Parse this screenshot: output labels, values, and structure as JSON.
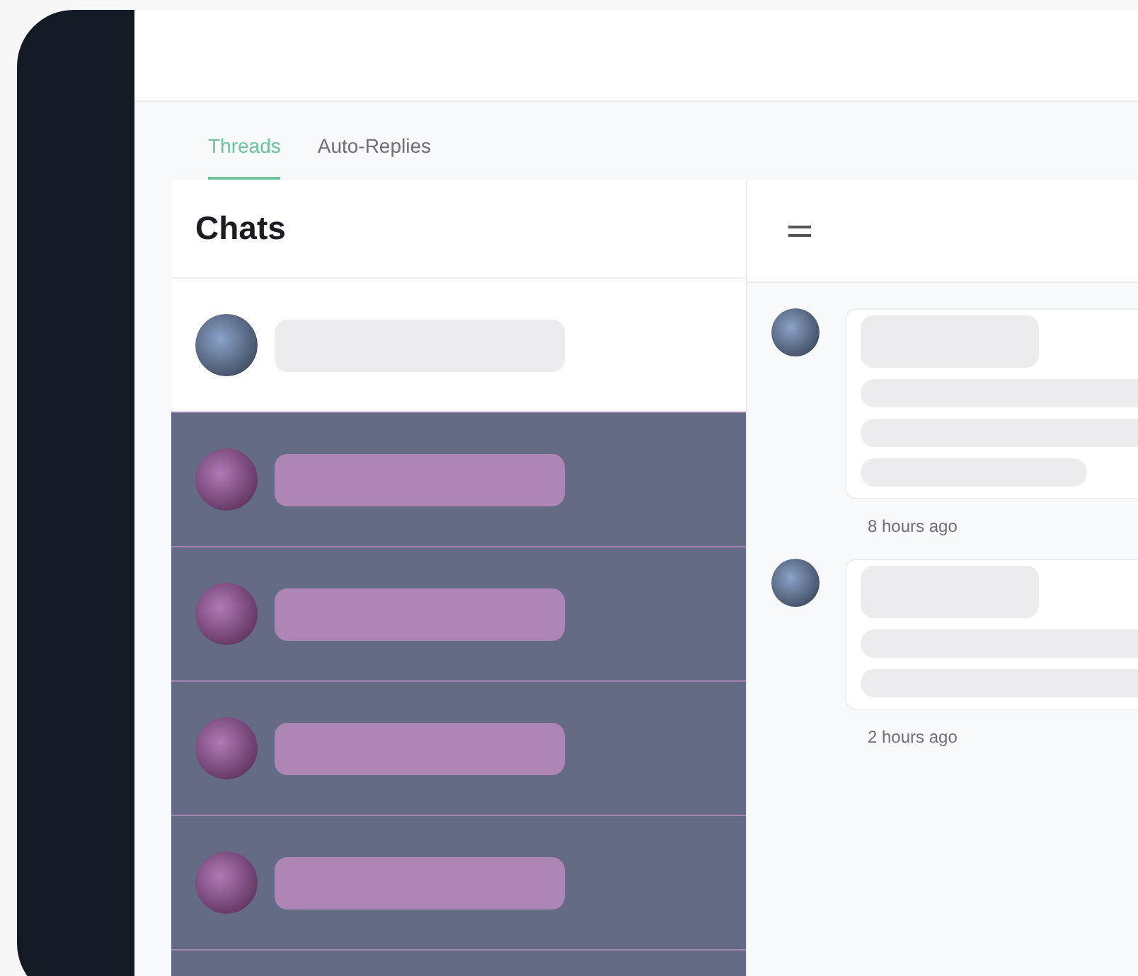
{
  "tabs": [
    {
      "label": "Threads",
      "selected": true
    },
    {
      "label": "Auto-Replies",
      "selected": false
    }
  ],
  "chats": {
    "title": "Chats",
    "rows": [
      {
        "highlighted": false
      },
      {
        "highlighted": true
      },
      {
        "highlighted": true
      },
      {
        "highlighted": true
      },
      {
        "highlighted": true
      },
      {
        "highlighted": true
      }
    ]
  },
  "thread": {
    "messages": [
      {
        "time": "8 hours ago"
      },
      {
        "time": "2 hours ago"
      }
    ]
  }
}
